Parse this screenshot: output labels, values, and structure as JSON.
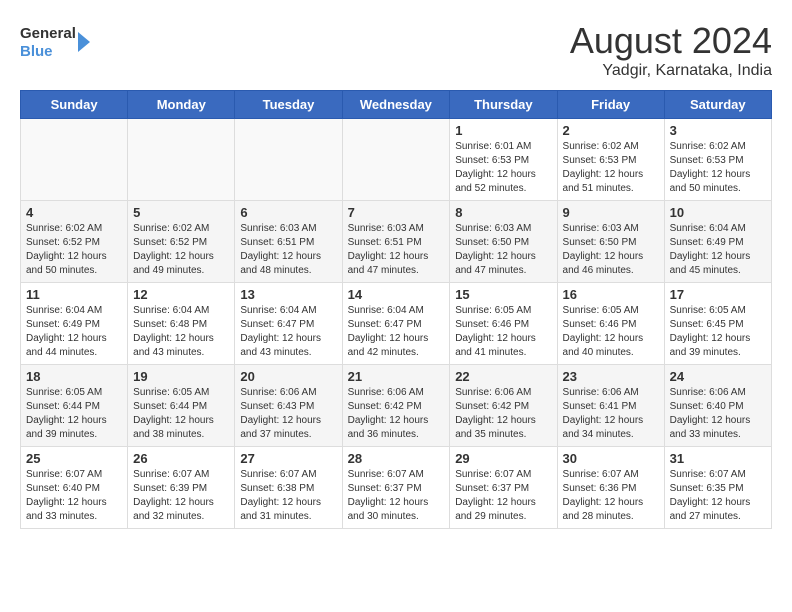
{
  "header": {
    "logo_line1": "General",
    "logo_line2": "Blue",
    "month_year": "August 2024",
    "location": "Yadgir, Karnataka, India"
  },
  "days_of_week": [
    "Sunday",
    "Monday",
    "Tuesday",
    "Wednesday",
    "Thursday",
    "Friday",
    "Saturday"
  ],
  "weeks": [
    [
      {
        "day": "",
        "info": ""
      },
      {
        "day": "",
        "info": ""
      },
      {
        "day": "",
        "info": ""
      },
      {
        "day": "",
        "info": ""
      },
      {
        "day": "1",
        "info": "Sunrise: 6:01 AM\nSunset: 6:53 PM\nDaylight: 12 hours\nand 52 minutes."
      },
      {
        "day": "2",
        "info": "Sunrise: 6:02 AM\nSunset: 6:53 PM\nDaylight: 12 hours\nand 51 minutes."
      },
      {
        "day": "3",
        "info": "Sunrise: 6:02 AM\nSunset: 6:53 PM\nDaylight: 12 hours\nand 50 minutes."
      }
    ],
    [
      {
        "day": "4",
        "info": "Sunrise: 6:02 AM\nSunset: 6:52 PM\nDaylight: 12 hours\nand 50 minutes."
      },
      {
        "day": "5",
        "info": "Sunrise: 6:02 AM\nSunset: 6:52 PM\nDaylight: 12 hours\nand 49 minutes."
      },
      {
        "day": "6",
        "info": "Sunrise: 6:03 AM\nSunset: 6:51 PM\nDaylight: 12 hours\nand 48 minutes."
      },
      {
        "day": "7",
        "info": "Sunrise: 6:03 AM\nSunset: 6:51 PM\nDaylight: 12 hours\nand 47 minutes."
      },
      {
        "day": "8",
        "info": "Sunrise: 6:03 AM\nSunset: 6:50 PM\nDaylight: 12 hours\nand 47 minutes."
      },
      {
        "day": "9",
        "info": "Sunrise: 6:03 AM\nSunset: 6:50 PM\nDaylight: 12 hours\nand 46 minutes."
      },
      {
        "day": "10",
        "info": "Sunrise: 6:04 AM\nSunset: 6:49 PM\nDaylight: 12 hours\nand 45 minutes."
      }
    ],
    [
      {
        "day": "11",
        "info": "Sunrise: 6:04 AM\nSunset: 6:49 PM\nDaylight: 12 hours\nand 44 minutes."
      },
      {
        "day": "12",
        "info": "Sunrise: 6:04 AM\nSunset: 6:48 PM\nDaylight: 12 hours\nand 43 minutes."
      },
      {
        "day": "13",
        "info": "Sunrise: 6:04 AM\nSunset: 6:47 PM\nDaylight: 12 hours\nand 43 minutes."
      },
      {
        "day": "14",
        "info": "Sunrise: 6:04 AM\nSunset: 6:47 PM\nDaylight: 12 hours\nand 42 minutes."
      },
      {
        "day": "15",
        "info": "Sunrise: 6:05 AM\nSunset: 6:46 PM\nDaylight: 12 hours\nand 41 minutes."
      },
      {
        "day": "16",
        "info": "Sunrise: 6:05 AM\nSunset: 6:46 PM\nDaylight: 12 hours\nand 40 minutes."
      },
      {
        "day": "17",
        "info": "Sunrise: 6:05 AM\nSunset: 6:45 PM\nDaylight: 12 hours\nand 39 minutes."
      }
    ],
    [
      {
        "day": "18",
        "info": "Sunrise: 6:05 AM\nSunset: 6:44 PM\nDaylight: 12 hours\nand 39 minutes."
      },
      {
        "day": "19",
        "info": "Sunrise: 6:05 AM\nSunset: 6:44 PM\nDaylight: 12 hours\nand 38 minutes."
      },
      {
        "day": "20",
        "info": "Sunrise: 6:06 AM\nSunset: 6:43 PM\nDaylight: 12 hours\nand 37 minutes."
      },
      {
        "day": "21",
        "info": "Sunrise: 6:06 AM\nSunset: 6:42 PM\nDaylight: 12 hours\nand 36 minutes."
      },
      {
        "day": "22",
        "info": "Sunrise: 6:06 AM\nSunset: 6:42 PM\nDaylight: 12 hours\nand 35 minutes."
      },
      {
        "day": "23",
        "info": "Sunrise: 6:06 AM\nSunset: 6:41 PM\nDaylight: 12 hours\nand 34 minutes."
      },
      {
        "day": "24",
        "info": "Sunrise: 6:06 AM\nSunset: 6:40 PM\nDaylight: 12 hours\nand 33 minutes."
      }
    ],
    [
      {
        "day": "25",
        "info": "Sunrise: 6:07 AM\nSunset: 6:40 PM\nDaylight: 12 hours\nand 33 minutes."
      },
      {
        "day": "26",
        "info": "Sunrise: 6:07 AM\nSunset: 6:39 PM\nDaylight: 12 hours\nand 32 minutes."
      },
      {
        "day": "27",
        "info": "Sunrise: 6:07 AM\nSunset: 6:38 PM\nDaylight: 12 hours\nand 31 minutes."
      },
      {
        "day": "28",
        "info": "Sunrise: 6:07 AM\nSunset: 6:37 PM\nDaylight: 12 hours\nand 30 minutes."
      },
      {
        "day": "29",
        "info": "Sunrise: 6:07 AM\nSunset: 6:37 PM\nDaylight: 12 hours\nand 29 minutes."
      },
      {
        "day": "30",
        "info": "Sunrise: 6:07 AM\nSunset: 6:36 PM\nDaylight: 12 hours\nand 28 minutes."
      },
      {
        "day": "31",
        "info": "Sunrise: 6:07 AM\nSunset: 6:35 PM\nDaylight: 12 hours\nand 27 minutes."
      }
    ]
  ]
}
